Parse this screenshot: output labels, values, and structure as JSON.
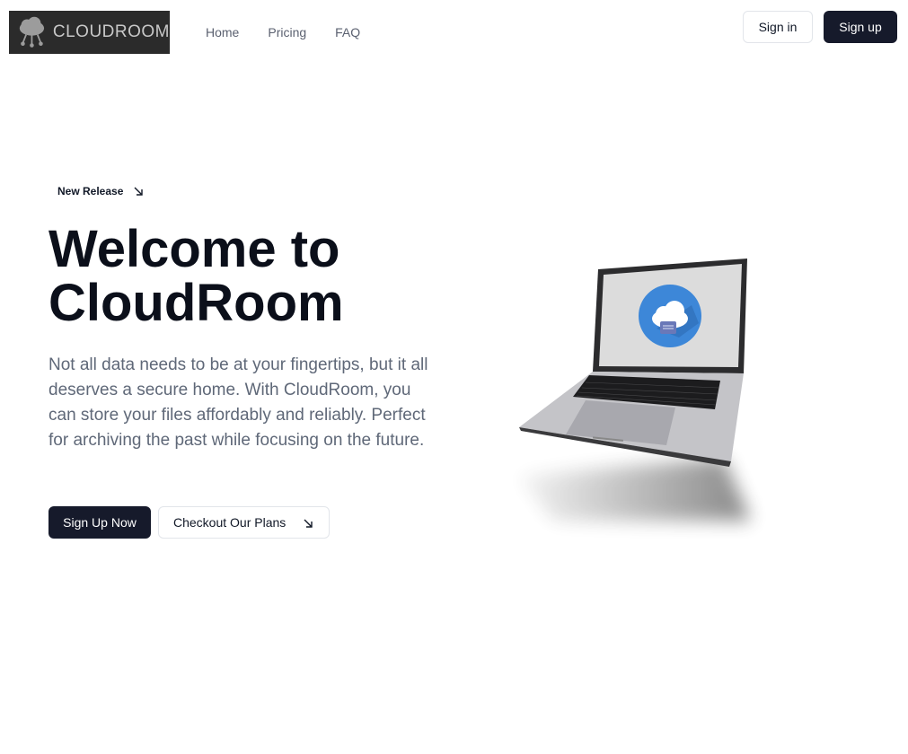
{
  "header": {
    "logo_text": "CLOUDROOM",
    "nav": [
      {
        "label": "Home"
      },
      {
        "label": "Pricing"
      },
      {
        "label": "FAQ"
      }
    ],
    "signin_label": "Sign in",
    "signup_label": "Sign up"
  },
  "hero": {
    "badge_label": "New Release",
    "title_line1": "Welcome to",
    "title_line2": "CloudRoom",
    "description": "Not all data needs to be at your fingertips, but it all deserves a secure home. With CloudRoom, you can store your files affordably and reliably. Perfect for archiving the past while focusing on the future.",
    "primary_cta": "Sign Up Now",
    "secondary_cta": "Checkout Our Plans"
  },
  "colors": {
    "primary_dark": "#161a2b",
    "text_muted": "#5f6878",
    "logo_bg": "#2b2b2b",
    "cloud_blue": "#3d87d8"
  },
  "icons": {
    "logo": "cloud-network-icon",
    "badge_arrow": "arrow-down-right-icon",
    "cta_arrow": "arrow-down-right-icon",
    "hero_image": "laptop-cloud-illustration"
  }
}
